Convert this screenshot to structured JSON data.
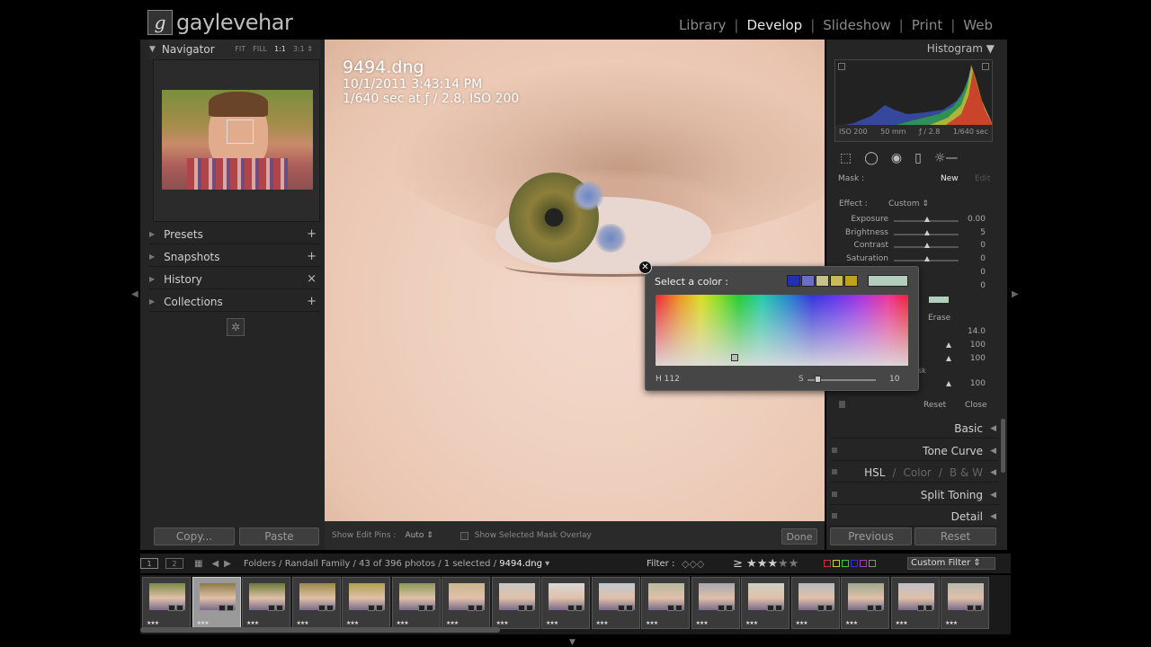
{
  "logo": {
    "mark": "g",
    "text": "gaylevehar"
  },
  "modules": [
    {
      "label": "Library",
      "active": false
    },
    {
      "label": "Develop",
      "active": true
    },
    {
      "label": "Slideshow",
      "active": false
    },
    {
      "label": "Print",
      "active": false
    },
    {
      "label": "Web",
      "active": false
    }
  ],
  "navigator": {
    "title": "Navigator",
    "options": [
      "FIT",
      "FILL",
      "1:1",
      "3:1 ⇕"
    ],
    "active_option": "1:1"
  },
  "left_sections": [
    {
      "label": "Presets",
      "action": "+"
    },
    {
      "label": "Snapshots",
      "action": "+"
    },
    {
      "label": "History",
      "action": "×"
    },
    {
      "label": "Collections",
      "action": "+"
    }
  ],
  "left_buttons": {
    "copy": "Copy...",
    "paste": "Paste"
  },
  "photo": {
    "filename": "9494.dng",
    "datetime": "10/1/2011 3:43:14 PM",
    "exposure": "1/640 sec at ƒ / 2.8, ISO 200"
  },
  "toolbar": {
    "edit_pins_label": "Show Edit Pins :",
    "edit_pins_value": "Auto ⇕",
    "mask_overlay_label": "Show Selected Mask Overlay",
    "done": "Done"
  },
  "histogram": {
    "title": "Histogram",
    "iso": "ISO 200",
    "focal": "50 mm",
    "aperture": "ƒ / 2.8",
    "shutter": "1/640 sec"
  },
  "tool_icons": [
    "crop-icon",
    "spot-removal-icon",
    "red-eye-icon",
    "graduated-filter-icon",
    "adjustment-brush-icon"
  ],
  "mask": {
    "label": "Mask :",
    "new": "New",
    "edit": "Edit"
  },
  "effect": {
    "label": "Effect :",
    "value": "Custom ⇕"
  },
  "sliders": [
    {
      "name": "Exposure",
      "value": "0.00",
      "pos": 0.5
    },
    {
      "name": "Brightness",
      "value": "5",
      "pos": 0.5
    },
    {
      "name": "Contrast",
      "value": "0",
      "pos": 0.5
    },
    {
      "name": "Saturation",
      "value": "0",
      "pos": 0.5
    },
    {
      "name": "",
      "value": "0",
      "pos": 0.5
    },
    {
      "name": "",
      "value": "0",
      "pos": 0.5
    }
  ],
  "brush": {
    "erase": "Erase",
    "values": [
      "14.0",
      "100",
      "100",
      "100"
    ],
    "mask_label": "sk",
    "reset": "Reset",
    "close": "Close"
  },
  "right_sections": [
    {
      "label": "Basic"
    },
    {
      "label": "Tone Curve"
    },
    {
      "label": "Split Toning"
    },
    {
      "label": "Detail"
    }
  ],
  "hsl": {
    "hsl": "HSL",
    "color": "Color",
    "bw": "B & W"
  },
  "right_buttons": {
    "previous": "Previous",
    "reset": "Reset"
  },
  "color_picker": {
    "title": "Select a color :",
    "swatches": [
      "#2030b0",
      "#6a6ec8",
      "#c4c090",
      "#c8bc5a",
      "#c0a020"
    ],
    "current": "#b4cebe",
    "h_label": "H",
    "h_value": "112",
    "s_label": "S",
    "s_value": "10",
    "s_level": 0.1
  },
  "filmbar": {
    "page1": "1",
    "page2": "2",
    "path": "Folders / Randall Family / 43 of 396 photos / 1 selected / ",
    "current": "9494.dng",
    "current_suffix": " ▾",
    "filter": "Filter :",
    "rating": "≥",
    "custom_filter": "Custom Filter ⇕"
  },
  "thumb_stars": "★★★",
  "thumb_colors": [
    "#7c8a4a",
    "#8a7a4a",
    "#6a7a3a",
    "#9a8a4a",
    "#b0a050",
    "#8a9a5a",
    "#c8b890",
    "#c8c8c8",
    "#d8d8d8",
    "#c0c8d0",
    "#b8b8a0",
    "#a8a8b0",
    "#d0d0c8",
    "#b8b8c0",
    "#a0a890",
    "#c0c0c8",
    "#b8b8b0"
  ],
  "selected_thumb": 1
}
